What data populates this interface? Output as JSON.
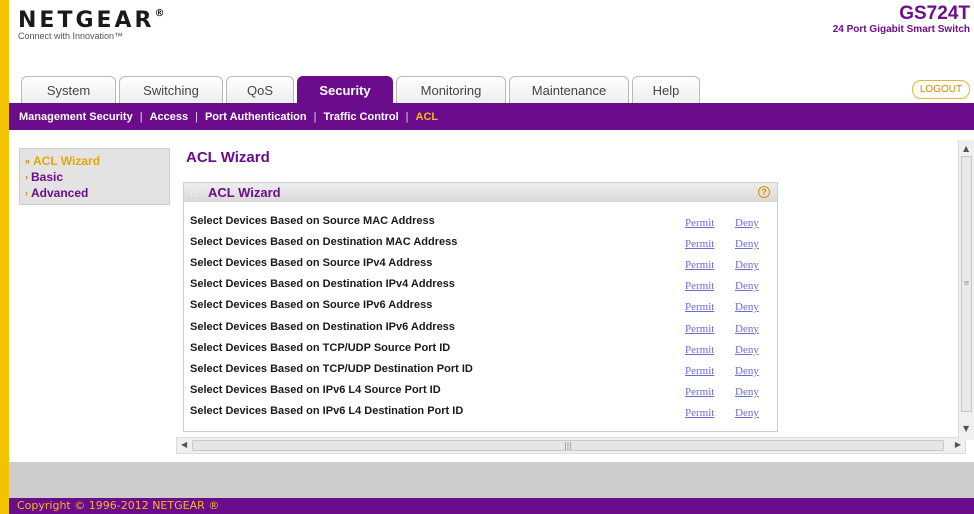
{
  "brand": {
    "logo": "NETGEAR",
    "registered": "®",
    "tagline": "Connect with Innovation™",
    "model": "GS724T",
    "description": "24 Port Gigabit Smart Switch"
  },
  "tabs": [
    {
      "label": "System",
      "active": false
    },
    {
      "label": "Switching",
      "active": false
    },
    {
      "label": "QoS",
      "active": false
    },
    {
      "label": "Security",
      "active": true
    },
    {
      "label": "Monitoring",
      "active": false
    },
    {
      "label": "Maintenance",
      "active": false
    },
    {
      "label": "Help",
      "active": false
    }
  ],
  "logout_label": "LOGOUT",
  "subnav": [
    {
      "label": "Management Security",
      "active": false
    },
    {
      "label": "Access",
      "active": false
    },
    {
      "label": "Port Authentication",
      "active": false
    },
    {
      "label": "Traffic Control",
      "active": false
    },
    {
      "label": "ACL",
      "active": true
    }
  ],
  "leftmenu": [
    {
      "label": "ACL Wizard",
      "active": true,
      "mark": "»"
    },
    {
      "label": "Basic",
      "active": false,
      "mark": "›"
    },
    {
      "label": "Advanced",
      "active": false,
      "mark": "›"
    }
  ],
  "page_title": "ACL Wizard",
  "panel": {
    "title": "ACL Wizard",
    "help": "?",
    "permit_label": "Permit",
    "deny_label": "Deny",
    "rows": [
      "Select Devices Based on Source MAC Address",
      "Select Devices Based on Destination MAC Address",
      "Select Devices Based on Source IPv4 Address",
      "Select Devices Based on Destination IPv4 Address",
      "Select Devices Based on Source IPv6 Address",
      "Select Devices Based on Destination IPv6 Address",
      "Select Devices Based on TCP/UDP Source Port ID",
      "Select Devices Based on TCP/UDP Destination Port ID",
      "Select Devices Based on IPv6 L4 Source Port ID",
      "Select Devices Based on IPv6 L4 Destination Port ID"
    ]
  },
  "footer": "Copyright © 1996-2012 NETGEAR ®",
  "colors": {
    "brand_purple": "#6b0c8c",
    "accent_orange": "#f3b81c",
    "link": "#6b6bd6"
  }
}
